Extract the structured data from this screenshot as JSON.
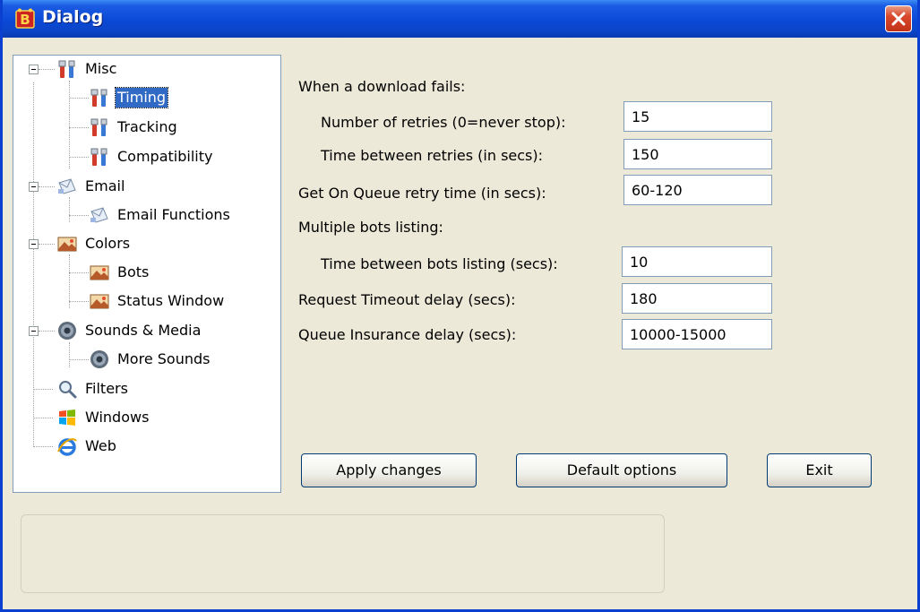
{
  "window": {
    "title": "Dialog"
  },
  "tree": [
    {
      "label": "Misc",
      "icon": "tools-icon"
    },
    {
      "label": "Timing",
      "icon": "tools-icon",
      "selected": true
    },
    {
      "label": "Tracking",
      "icon": "tools-icon"
    },
    {
      "label": "Compatibility",
      "icon": "tools-icon"
    },
    {
      "label": "Email",
      "icon": "email-icon"
    },
    {
      "label": "Email Functions",
      "icon": "email-icon"
    },
    {
      "label": "Colors",
      "icon": "colors-icon"
    },
    {
      "label": "Bots",
      "icon": "colors-icon"
    },
    {
      "label": "Status Window",
      "icon": "colors-icon"
    },
    {
      "label": "Sounds & Media",
      "icon": "speaker-icon"
    },
    {
      "label": "More Sounds",
      "icon": "speaker-icon"
    },
    {
      "label": "Filters",
      "icon": "magnifier-icon"
    },
    {
      "label": "Windows",
      "icon": "windows-logo-icon"
    },
    {
      "label": "Web",
      "icon": "internet-explorer-icon"
    }
  ],
  "settings": {
    "download_fails_heading": "When a download fails:",
    "retries_label": "Number of retries (0=never stop):",
    "retries_value": "15",
    "retry_interval_label": "Time between retries (in secs):",
    "retry_interval_value": "150",
    "queue_retry_label": "Get On Queue retry time (in secs):",
    "queue_retry_value": "60-120",
    "bots_listing_heading": "Multiple bots listing:",
    "bots_interval_label": "Time between bots listing (secs):",
    "bots_interval_value": "10",
    "request_timeout_label": "Request Timeout delay (secs):",
    "request_timeout_value": "180",
    "queue_insurance_label": "Queue Insurance delay (secs):",
    "queue_insurance_value": "10000-15000"
  },
  "buttons": {
    "apply": "Apply changes",
    "defaults": "Default options",
    "exit": "Exit"
  },
  "colors": {
    "titlebar": "#0a49d6",
    "selection": "#316ac5",
    "dialog_bg": "#ece9d8"
  }
}
